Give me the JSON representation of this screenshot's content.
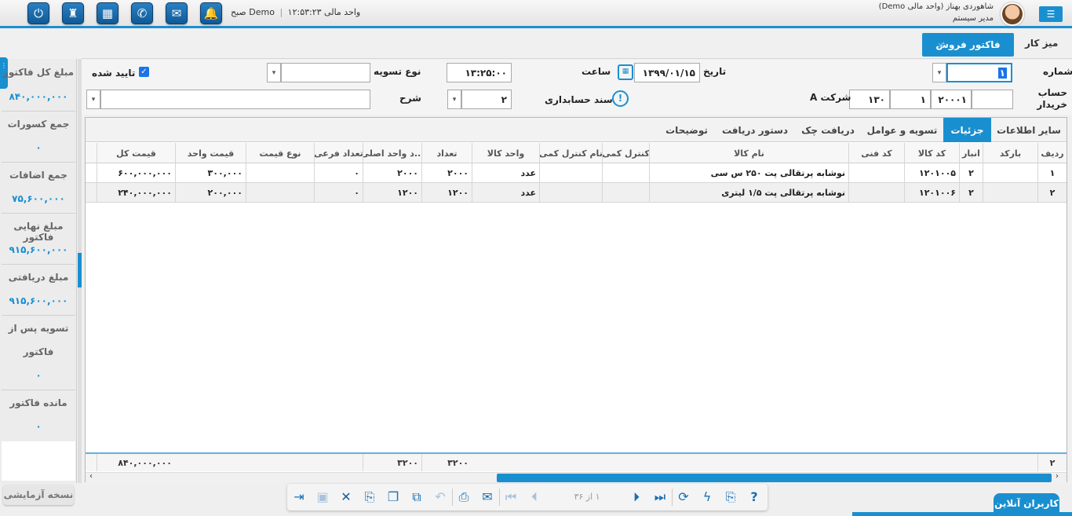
{
  "topbar": {
    "unit_label": "واحد مالی",
    "unit_name": "Demo",
    "clock": "۱۲:۵۳:۲۳ صبح",
    "user_name": "شاهوردی بهناز (واحد مالی Demo)",
    "user_role": "مدیر سیستم",
    "buttons": [
      "power-icon",
      "printer-bell-icon",
      "calculator-icon",
      "phone-icon",
      "mail-icon",
      "bell-icon"
    ]
  },
  "tabs": {
    "desk": "میز کار",
    "active": "فاکتور فروش",
    "close": "×"
  },
  "summary": {
    "items": [
      {
        "label": "مبلغ کل فاکتور",
        "value": "۸۴۰,۰۰۰,۰۰۰"
      },
      {
        "label": "جمع کسورات",
        "value": "۰"
      },
      {
        "label": "جمع اضافات",
        "value": "۷۵,۶۰۰,۰۰۰"
      },
      {
        "label": "مبلغ نهایی فاکتور",
        "value": "۹۱۵,۶۰۰,۰۰۰"
      },
      {
        "label": "مبلغ دریافتی",
        "value": "۹۱۵,۶۰۰,۰۰۰"
      },
      {
        "label": "تسویه پس از",
        "label2": "فاکتور",
        "value": "۰"
      },
      {
        "label": "مانده فاکتور",
        "value": "۰"
      }
    ]
  },
  "form": {
    "number_label": "شماره",
    "number_value": "۱",
    "date_label": "تاریخ",
    "date_value": "۱۳۹۹/۰۱/۱۵",
    "time_label": "ساعت",
    "time_value": "۱۳:۲۵:۰۰",
    "settle_label": "نوع تسویه",
    "settle_value": "",
    "approved_label": "تایید شده",
    "approved": true,
    "buyer_label": "حساب خریدار",
    "buyer_code1": "۲۰۰۰۱",
    "buyer_code2": "۱",
    "buyer_code3": "۱۳۰",
    "buyer_name": "شرکت A",
    "voucher_label": "سند حسابداری",
    "desc_label": "شرح",
    "desc_value": "",
    "desc_select": "۲"
  },
  "subtabs": [
    "سایر اطلاعات",
    "جزئیات",
    "تسویه و عوامل",
    "دریافت چک",
    "دستور دریافت",
    "توضیحات"
  ],
  "grid": {
    "columns": [
      "ردیف",
      "بارکد",
      "انبار",
      "کد کالا",
      "کد فنی",
      "نام کالا",
      "کنترل کمی",
      "نام کنترل کمی",
      "واحد کالا",
      "تعداد",
      "...د واحد اصلی",
      "تعداد فرعی",
      "نوع قیمت",
      "قیمت واحد",
      "قیمت کل"
    ],
    "rows": [
      {
        "row": "۱",
        "barcode": "",
        "warehouse": "۲",
        "code": "۱۲۰۱۰۰۵",
        "tech": "",
        "name": "نوشابه پرتقالی پت ۲۵۰ س سی",
        "qc": "",
        "qc_name": "",
        "unit": "عدد",
        "qty": "۲۰۰۰",
        "qty_main": "۲۰۰۰",
        "qty_sub": "۰",
        "price_type": "",
        "unit_price": "۳۰۰,۰۰۰",
        "total": "۶۰۰,۰۰۰,۰۰۰"
      },
      {
        "row": "۲",
        "barcode": "",
        "warehouse": "۲",
        "code": "۱۲۰۱۰۰۶",
        "tech": "",
        "name": "نوشابه پرتقالی پت ۱/۵ لیتری",
        "qc": "",
        "qc_name": "",
        "unit": "عدد",
        "qty": "۱۲۰۰",
        "qty_main": "۱۲۰۰",
        "qty_sub": "۰",
        "price_type": "",
        "unit_price": "۲۰۰,۰۰۰",
        "total": "۲۴۰,۰۰۰,۰۰۰"
      }
    ],
    "footer": {
      "count": "۲",
      "qty": "۳۲۰۰",
      "qty_main": "۳۲۰۰",
      "total": "۸۴۰,۰۰۰,۰۰۰"
    }
  },
  "bottom": {
    "trial": "نسخه آزمایشی",
    "pager": "۱ از ۳۶",
    "online": "کاربران آنلاین"
  },
  "colors": {
    "accent": "#1a8fd0"
  }
}
